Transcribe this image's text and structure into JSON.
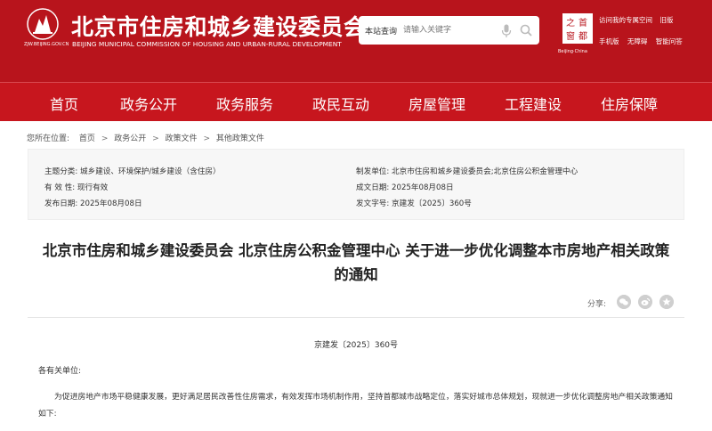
{
  "header": {
    "title": "北京市住房和城乡建设委员会",
    "subtitle": "BEIJING MUNICIPAL COMMISSION OF HOUSING AND URBAN-RURAL DEVELOPMENT",
    "logo_domain": "ZJW.BEIJING.GOV.CN",
    "background_color": "#b8141c"
  },
  "search": {
    "scope": "本站查询",
    "placeholder": "请输入关键字",
    "mic_icon": "microphone-icon",
    "search_icon": "search-icon"
  },
  "capital_logo": {
    "chars": [
      "首",
      "都",
      "之",
      "窗"
    ],
    "caption": "Beijing·China"
  },
  "toplinks": {
    "row1": [
      "访问我的专属空间",
      "旧版"
    ],
    "row2": [
      "手机版",
      "无障碍",
      "智能问答"
    ]
  },
  "nav": {
    "items": [
      "首页",
      "政务公开",
      "政务服务",
      "政民互动",
      "房屋管理",
      "工程建设",
      "住房保障"
    ]
  },
  "breadcrumb": {
    "prefix": "您所在位置:",
    "items": [
      "首页",
      "政务公开",
      "政策文件",
      "其他政策文件"
    ],
    "separator": ">"
  },
  "meta": {
    "topic_label": "主题分类:",
    "topic_value": "城乡建设、环境保护/城乡建设（含住房）",
    "validity_label": "有 效 性:",
    "validity_value": "现行有效",
    "publish_label": "发布日期:",
    "publish_value": "2025年08月08日",
    "issuer_label": "制发单位:",
    "issuer_value": "北京市住房和城乡建设委员会;北京住房公积金管理中心",
    "created_label": "成文日期:",
    "created_value": "2025年08月08日",
    "docno_label": "发文字号:",
    "docno_value": "京建发〔2025〕360号"
  },
  "document": {
    "title_line1": "北京市住房和城乡建设委员会 北京住房公积金管理中心 关于进一步优化调整本市房地产相关政策",
    "title_line2": "的通知",
    "share_label": "分享:",
    "share_icons": [
      "wechat-icon",
      "weibo-icon",
      "favorite-icon"
    ],
    "number": "京建发〔2025〕360号",
    "salutation": "各有关单位:",
    "body": "为促进房地产市场平稳健康发展，更好满足居民改善性住房需求，有效发挥市场机制作用，坚持首都城市战略定位，落实好城市总体规划，现就进一步优化调整房地产相关政策通知如下:"
  }
}
